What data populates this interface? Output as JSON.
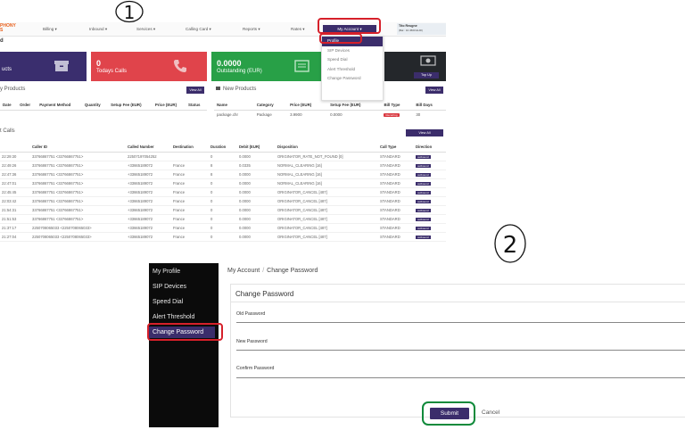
{
  "markers": {
    "first": "1",
    "second": "2"
  },
  "panel1": {
    "logo": "PHONY\nS",
    "nav": {
      "billing": "Billing ▾",
      "inbound": "Inbound ▾",
      "services": "Services ▾",
      "calling_card": "Calling Card ▾",
      "reports": "Reports ▾",
      "rates": "Rates ▾",
      "my_account": "My Account ▾"
    },
    "user": {
      "name": "Tito Reugne",
      "balance": "(Bal : 10.4500 EUR)"
    },
    "page_heading": "d",
    "account_menu": [
      "Profile",
      "SIP Devices",
      "Speed Dial",
      "Alert Threshold",
      "Change Password"
    ],
    "tiles": [
      {
        "value": "",
        "label": "ucts",
        "color": "#3a2e6e",
        "icon": "package-icon"
      },
      {
        "value": "0",
        "label": "Todays Calls",
        "color": "#e0444b",
        "icon": "phone-icon"
      },
      {
        "value": "0.0000",
        "label": "Outstanding (EUR)",
        "color": "#28a047",
        "icon": "invoice-icon"
      },
      {
        "value": "",
        "label": "",
        "color": "#24272b",
        "icon": "cash-icon",
        "button": "Top Up"
      }
    ],
    "my_products": {
      "title": "y Products",
      "view_all": "View All",
      "columns": [
        "Date",
        "Order",
        "Payment Method",
        "Quantity",
        "Setup Fee (EUR)",
        "Price (EUR)",
        "Status"
      ]
    },
    "new_products": {
      "title": "New Products",
      "view_all": "View All",
      "columns": [
        "Name",
        "Category",
        "Price (EUR)",
        "Setup Fee (EUR)",
        "Bill Type",
        "Bill Days"
      ],
      "rows": [
        {
          "name": "package.chr",
          "category": "Package",
          "price": "3.9900",
          "setup": "0.0000",
          "bill_type": "Recurring",
          "bill_days": "30"
        }
      ]
    },
    "calls": {
      "title": "t Calls",
      "view_all": "View All",
      "columns": [
        "",
        "Caller ID",
        "Called Number",
        "Destination",
        "Duration",
        "Debit (EUR)",
        "Disposition",
        "Call Type",
        "Direction"
      ],
      "rows": [
        [
          "22:29:30",
          "33766867751 <33766867751>",
          "22507197054252",
          "",
          "0",
          "0.0000",
          "ORIGINATOR_RATE_NOT_FOUND [0]",
          "STANDARD",
          "outbound"
        ],
        [
          "22:49:26",
          "33766867751 <33766867751>",
          "+33665189072",
          "France",
          "8",
          "0.0335",
          "NORMAL_CLEARING [16]",
          "STANDARD",
          "outbound"
        ],
        [
          "22:47:36",
          "33766867751 <33766867751>",
          "+33665189072",
          "France",
          "8",
          "0.0000",
          "NORMAL_CLEARING [16]",
          "STANDARD",
          "outbound"
        ],
        [
          "22:47:01",
          "33766867751 <33766867751>",
          "+33665189072",
          "France",
          "0",
          "0.0000",
          "NORMAL_CLEARING [16]",
          "STANDARD",
          "outbound"
        ],
        [
          "22:45:45",
          "33766867751 <33766867751>",
          "+33665189072",
          "France",
          "0",
          "0.0000",
          "ORIGINATOR_CANCEL [487]",
          "STANDARD",
          "outbound"
        ],
        [
          "22:03:42",
          "33766867751 <33766867751>",
          "+33665189072",
          "France",
          "0",
          "0.0000",
          "ORIGINATOR_CANCEL [487]",
          "STANDARD",
          "outbound"
        ],
        [
          "21:54:31",
          "33766867751 <33766867751>",
          "+33665189072",
          "France",
          "0",
          "0.0000",
          "ORIGINATOR_CANCEL [487]",
          "STANDARD",
          "outbound"
        ],
        [
          "21:51:53",
          "33766867751 <33766867751>",
          "+33665189072",
          "France",
          "0",
          "0.0000",
          "ORIGINATOR_CANCEL [487]",
          "STANDARD",
          "outbound"
        ],
        [
          "21:37:17",
          "2250708065033 <2250708065033>",
          "+33665189072",
          "France",
          "0",
          "0.0000",
          "ORIGINATOR_CANCEL [487]",
          "STANDARD",
          "outbound"
        ],
        [
          "21:27:04",
          "2250708065033 <2250708065033>",
          "+33665189072",
          "France",
          "0",
          "0.0000",
          "ORIGINATOR_CANCEL [487]",
          "STANDARD",
          "outbound"
        ]
      ]
    }
  },
  "panel2": {
    "sidebar": [
      "My Profile",
      "SIP Devices",
      "Speed Dial",
      "Alert Threshold",
      "Change Password"
    ],
    "breadcrumb": {
      "parent": "My Account",
      "current": "Change Password"
    },
    "card_title": "Change Password",
    "fields": {
      "old": "Old Password",
      "new": "New Password",
      "confirm": "Confirm Password"
    },
    "submit": "Submit",
    "cancel": "Cancel"
  },
  "colors": {
    "brand": "#3b2d6b",
    "annotation_red": "#d6202a",
    "annotation_green": "#108a3b"
  }
}
